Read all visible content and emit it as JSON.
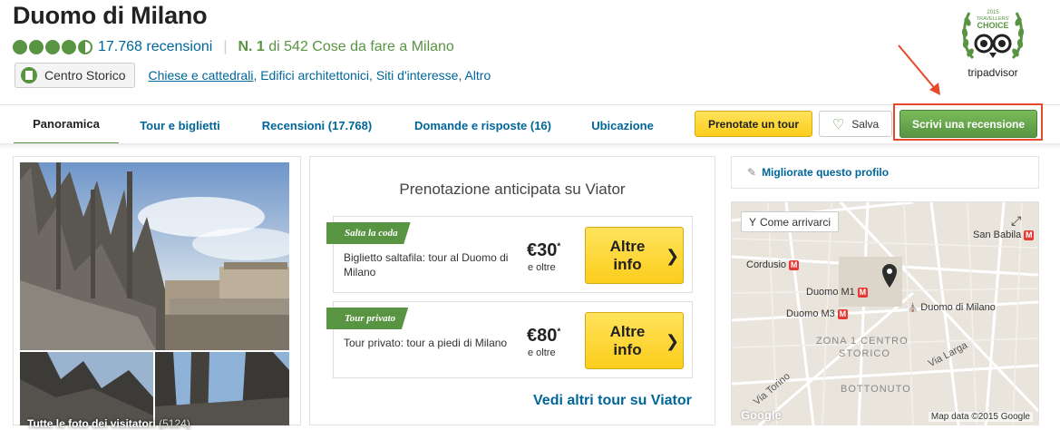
{
  "header": {
    "title": "Duomo di Milano",
    "rating": 4.5,
    "review_count": "17.768 recensioni",
    "rank_prefix": "N. 1",
    "rank_suffix": " di 542 Cose da fare a Milano",
    "neighborhood": "Centro Storico",
    "categories": [
      "Chiese e cattedrali",
      ", Edifici architettonici",
      ", Siti d'interesse",
      ", Altro"
    ]
  },
  "badge": {
    "year": "2015",
    "line1": "TRAVELLERS'",
    "line2": "CHOICE",
    "brand": "tripadvisor"
  },
  "nav": {
    "tabs": [
      {
        "label": "Panoramica",
        "active": true
      },
      {
        "label": "Tour e biglietti"
      },
      {
        "label": "Recensioni (17.768)"
      },
      {
        "label": "Domande e risposte (16)"
      },
      {
        "label": "Ubicazione"
      }
    ],
    "book_tour": "Prenotate un tour",
    "save": "Salva",
    "write_review": "Scrivi una recensione"
  },
  "photos": {
    "caption": "Tutte le foto dei visitatori",
    "count": "(5124)"
  },
  "viator": {
    "title": "Prenotazione anticipata su Viator",
    "tours": [
      {
        "ribbon": "Salta la coda",
        "desc": "Biglietto saltafila: tour al Duomo di Milano",
        "price": "€30",
        "price_mark": "*",
        "price_sub": "e oltre",
        "button_line1": "Altre",
        "button_line2": "info"
      },
      {
        "ribbon": "Tour privato",
        "desc": "Tour privato: tour a piedi di Milano",
        "price": "€80",
        "price_mark": "*",
        "price_sub": "e oltre",
        "button_line1": "Altre",
        "button_line2": "info"
      }
    ],
    "more_link": "Vedi altri tour su Viator"
  },
  "sidebar": {
    "improve": "Migliorate questo profilo",
    "map": {
      "how_to_get": "Come arrivarci",
      "labels": {
        "san_babila": "San Babila",
        "cordusio": "Cordusio",
        "duomo_m1": "Duomo M1",
        "duomo_m3": "Duomo M3",
        "duomo_di_milano": "Duomo di Milano",
        "zona1": "ZONA 1 CENTRO",
        "storico": "STORICO",
        "via_larga": "Via Larga",
        "via_torino": "Via Torino",
        "bottonuto": "BOTTONUTO",
        "metro": "M"
      },
      "attribution": "Map data ©2015 Google",
      "google": "Google"
    }
  }
}
